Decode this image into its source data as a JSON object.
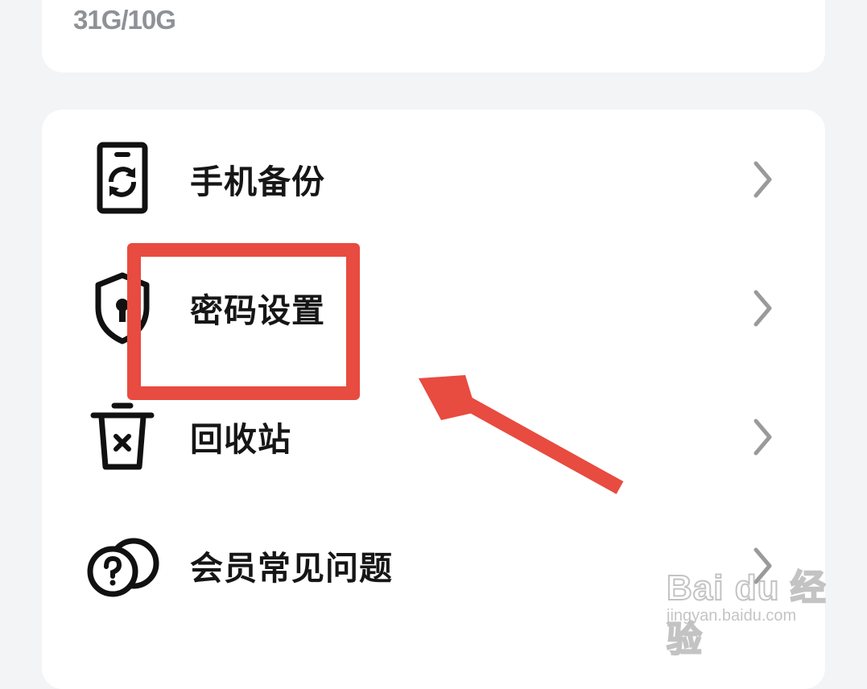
{
  "storage": {
    "usage": "31G/10G"
  },
  "menu": {
    "items": [
      {
        "label": "手机备份",
        "icon": "phone-backup-icon"
      },
      {
        "label": "密码设置",
        "icon": "shield-lock-icon"
      },
      {
        "label": "回收站",
        "icon": "trash-icon"
      },
      {
        "label": "会员常见问题",
        "icon": "help-coins-icon"
      }
    ]
  },
  "annotation": {
    "color": "#e84b40"
  },
  "watermark": {
    "brand": "Bai du 经验",
    "url": "jingyan.baidu.com"
  },
  "colors": {
    "background": "#f3f4f6",
    "card": "#ffffff",
    "text": "#161616",
    "muted": "#8e9196",
    "chevron": "#9a9a9a"
  }
}
